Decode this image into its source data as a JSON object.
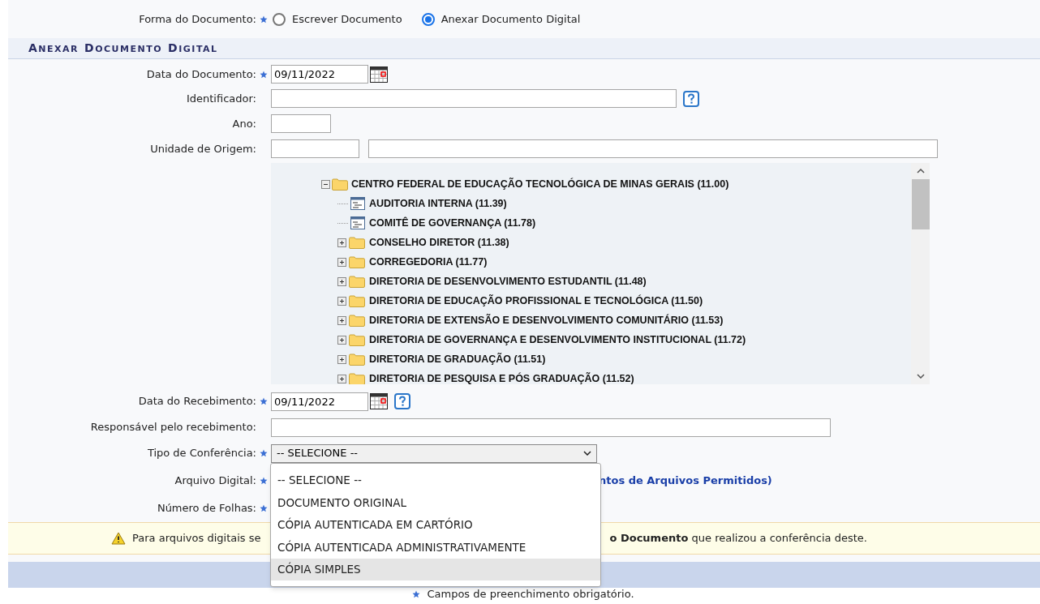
{
  "forma": {
    "label": "Forma do Documento:",
    "required": true,
    "options": [
      {
        "label": "Escrever Documento",
        "selected": false
      },
      {
        "label": "Anexar Documento Digital",
        "selected": true
      }
    ]
  },
  "section_title": "ANEXAR DOCUMENTO DIGITAL",
  "data_documento": {
    "label": "Data do Documento:",
    "required": true,
    "value": "09/11/2022"
  },
  "identificador": {
    "label": "Identificador:",
    "required": false
  },
  "ano": {
    "label": "Ano:",
    "required": false
  },
  "unidade_origem": {
    "label": "Unidade de Origem:",
    "required": false
  },
  "tree": {
    "label": "CENTRO FEDERAL DE EDUCAÇÃO TECNOLÓGICA DE MINAS GERAIS (11.00)",
    "expanded": true,
    "children": [
      {
        "kind": "unit",
        "label": "AUDITORIA INTERNA (11.39)"
      },
      {
        "kind": "unit",
        "label": "COMITÊ DE GOVERNANÇA (11.78)"
      },
      {
        "kind": "folder",
        "label": "CONSELHO DIRETOR (11.38)",
        "expanded": false
      },
      {
        "kind": "folder",
        "label": "CORREGEDORIA (11.77)",
        "expanded": false
      },
      {
        "kind": "folder",
        "label": "DIRETORIA DE DESENVOLVIMENTO ESTUDANTIL (11.48)",
        "expanded": false
      },
      {
        "kind": "folder",
        "label": "DIRETORIA DE EDUCAÇÃO PROFISSIONAL E TECNOLÓGICA (11.50)",
        "expanded": false
      },
      {
        "kind": "folder",
        "label": "DIRETORIA DE EXTENSÃO E DESENVOLVIMENTO COMUNITÁRIO (11.53)",
        "expanded": false
      },
      {
        "kind": "folder",
        "label": "DIRETORIA DE GOVERNANÇA E DESENVOLVIMENTO INSTITUCIONAL (11.72)",
        "expanded": false
      },
      {
        "kind": "folder",
        "label": "DIRETORIA DE GRADUAÇÃO (11.51)",
        "expanded": false
      },
      {
        "kind": "folder",
        "label": "DIRETORIA DE PESQUISA E PÓS GRADUAÇÃO (11.52)",
        "expanded": false
      }
    ]
  },
  "data_recebimento": {
    "label": "Data do Recebimento:",
    "required": true,
    "value": "09/11/2022"
  },
  "responsavel": {
    "label": "Responsável pelo recebimento:",
    "required": false
  },
  "tipo_conferencia": {
    "label": "Tipo de Conferência:",
    "required": true,
    "value": "-- SELECIONE --",
    "expanded": true,
    "options": [
      {
        "label": "-- SELECIONE --",
        "highlighted": false
      },
      {
        "label": "DOCUMENTO ORIGINAL",
        "highlighted": false
      },
      {
        "label": "CÓPIA AUTENTICADA EM CARTÓRIO",
        "highlighted": false
      },
      {
        "label": "CÓPIA AUTENTICADA ADMINISTRATIVAMENTE",
        "highlighted": false
      },
      {
        "label": "CÓPIA SIMPLES",
        "highlighted": true
      }
    ]
  },
  "arquivo_digital": {
    "label": "Arquivo Digital:",
    "required": true,
    "link": "ntos de Arquivos Permitidos)"
  },
  "numero_folhas": {
    "label": "Número de Folhas:",
    "required": true
  },
  "warning": {
    "text_before": "Para arquivos digitais se",
    "text_after": "**o Documento** que realizou a conferência deste."
  },
  "footnote": "Campos de preenchimento obrigatório."
}
